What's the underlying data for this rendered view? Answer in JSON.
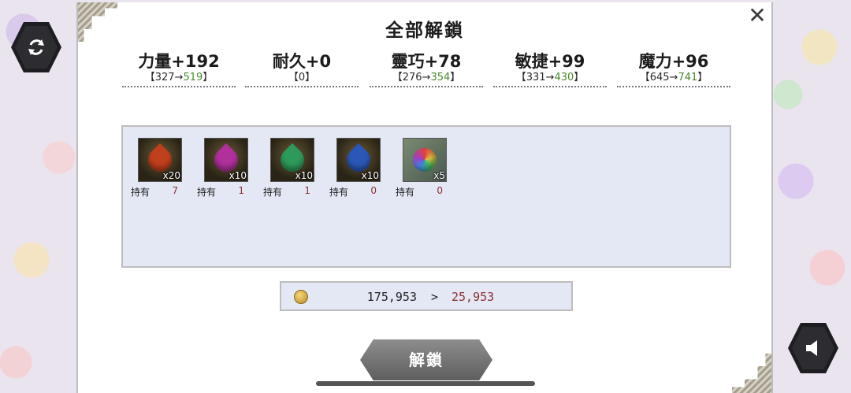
{
  "dialog": {
    "title": "全部解鎖",
    "close_label": "✕"
  },
  "stats": [
    {
      "label": "力量+192",
      "from": "327",
      "to": "519"
    },
    {
      "label": "耐久+0",
      "from": "0",
      "to": ""
    },
    {
      "label": "靈巧+78",
      "from": "276",
      "to": "354"
    },
    {
      "label": "敏捷+99",
      "from": "331",
      "to": "430"
    },
    {
      "label": "魔力+96",
      "from": "645",
      "to": "741"
    }
  ],
  "items": [
    {
      "icon": "red-crystal-icon",
      "color": "#c0401e",
      "qty": "x20",
      "owned_label": "持有",
      "owned": "7"
    },
    {
      "icon": "purple-crystal-icon",
      "color": "#b0309c",
      "qty": "x10",
      "owned_label": "持有",
      "owned": "1"
    },
    {
      "icon": "green-crystal-icon",
      "color": "#2e9a5a",
      "qty": "x10",
      "owned_label": "持有",
      "owned": "1"
    },
    {
      "icon": "blue-crystal-icon",
      "color": "#2b58b8",
      "qty": "x10",
      "owned_label": "持有",
      "owned": "0"
    },
    {
      "icon": "rainbow-orb-icon",
      "color": "#7a7ab0",
      "qty": "x5",
      "owned_label": "持有",
      "owned": "0"
    }
  ],
  "cost": {
    "icon": "gold-coin-icon",
    "current": "175,953",
    "arrow": ">",
    "after": "25,953"
  },
  "unlock_button": "解鎖",
  "side_buttons": {
    "left": "refresh-icon",
    "right": "speaker-icon"
  }
}
